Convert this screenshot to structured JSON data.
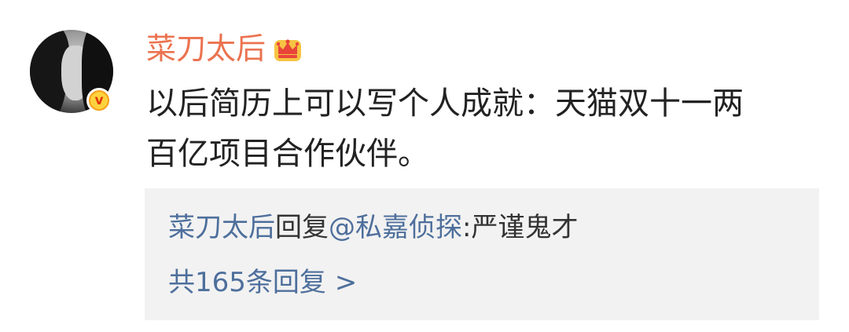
{
  "user": {
    "name": "菜刀太后",
    "avatar": "avatar-photo",
    "badge_icon": "verified-v-icon",
    "badge_letter": "v",
    "vip_icon": "crown-icon"
  },
  "comment": {
    "line1": "以后简历上可以写个人成就：天猫双十一两",
    "line2": "百亿项目合作伙伴。"
  },
  "reply_preview": {
    "author": "菜刀太后",
    "action": "回复",
    "mention": "@私嘉侦探",
    "separator": ":",
    "text": "严谨鬼才",
    "count_label": "共165条回复 >"
  },
  "colors": {
    "username": "#eb7350",
    "link": "#4e6f9c",
    "reply_bg": "#f2f2f2"
  }
}
